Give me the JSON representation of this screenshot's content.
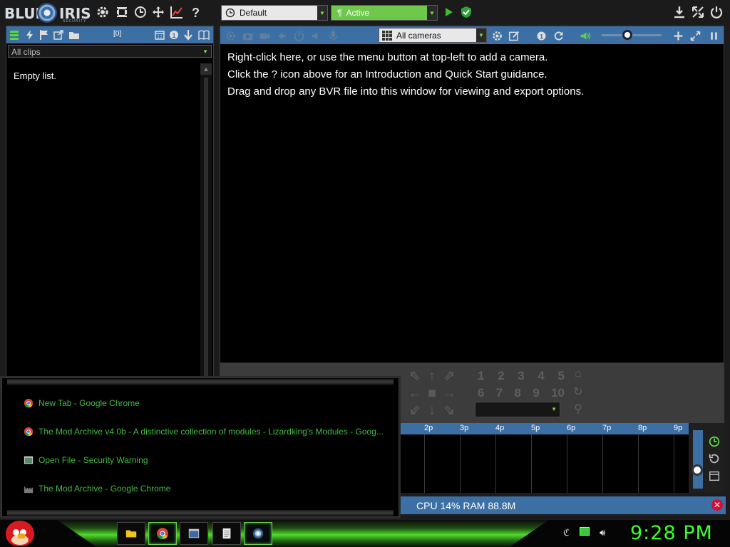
{
  "app": {
    "logo_left": "BLUE",
    "logo_right": "IRIS",
    "logo_sub": "SECURITY"
  },
  "toolbar": {
    "profile_select": "Default",
    "schedule_select": "Active"
  },
  "clips": {
    "count": "[0]",
    "filter_select": "All clips",
    "empty_text": "Empty list."
  },
  "main": {
    "camera_select": "All cameras",
    "volume_level": 0.42,
    "info_lines": [
      "Right-click here, or use the menu button at top-left to add a camera.",
      "Click the ? icon above for an Introduction and Quick Start guidance.",
      "Drag and drop any BVR file into this window for viewing and export options."
    ]
  },
  "ptz": {
    "preset_rows": [
      [
        "1",
        "2",
        "3",
        "4",
        "5"
      ],
      [
        "6",
        "7",
        "8",
        "9",
        "10"
      ]
    ]
  },
  "timeline": {
    "labels": [
      "2p",
      "3p",
      "4p",
      "5p",
      "6p",
      "7p",
      "8p",
      "9p"
    ]
  },
  "status": {
    "text": "CPU 14% RAM 88.8M"
  },
  "jumplist": {
    "items": [
      {
        "label": "New Tab - Google Chrome",
        "icon": "chrome-icon"
      },
      {
        "label": "The Mod Archive v4.0b - A distinctive collection of modules - Lizardking's Modules - Goog...",
        "icon": "chrome-icon"
      },
      {
        "label": "Open File - Security Warning",
        "icon": "window-icon"
      },
      {
        "label": "The Mod Archive - Google Chrome",
        "icon": "factory-icon"
      }
    ]
  },
  "taskbar": {
    "clock": "9:28 PM"
  },
  "colors": {
    "accent_blue": "#3c6fa3",
    "active_green": "#6ec94b",
    "clock_green": "#3cff2c"
  }
}
